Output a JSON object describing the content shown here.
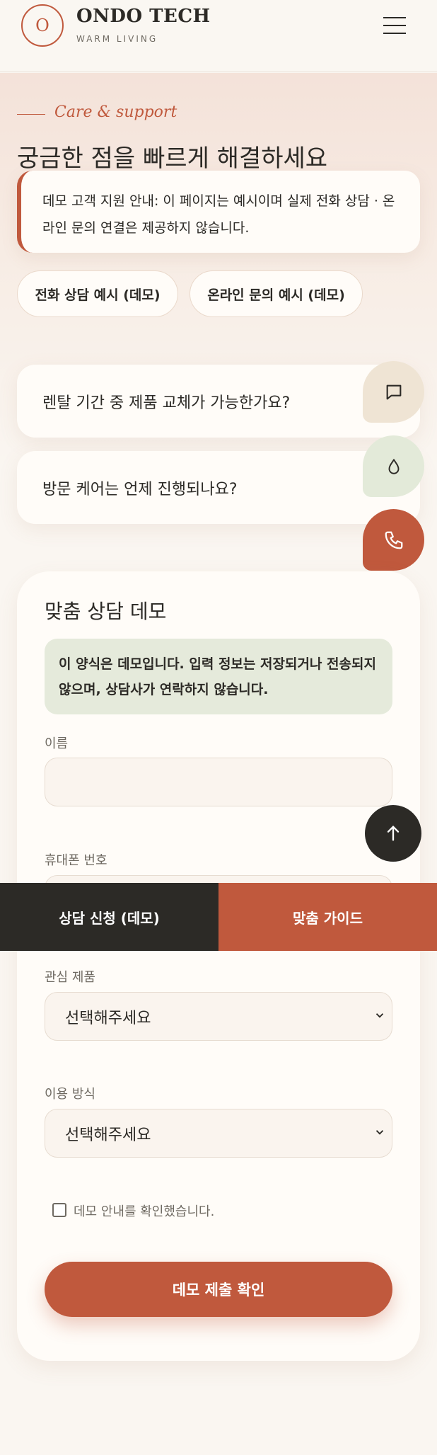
{
  "header": {
    "logo_letter": "O",
    "brand": "ONDO TECH",
    "tagline": "WARM LIVING",
    "menu_icon": "hamburger-icon"
  },
  "hero": {
    "eyebrow": "Care & support",
    "title": "궁금한 점을 빠르게 해결하세요",
    "notice": "데모 고객 지원 안내: 이 페이지는 예시이며 실제 전화 상담 · 온라인 문의 연결은 제공하지 않습니다.",
    "buttons": [
      {
        "label": "전화 상담 예시 (데모)"
      },
      {
        "label": "온라인 문의 예시 (데모)"
      }
    ]
  },
  "faq": [
    {
      "question": "렌탈 기간 중 제품 교체가 가능한가요?"
    },
    {
      "question": "방문 케어는 언제 진행되나요?"
    }
  ],
  "floating": {
    "chat_icon": "chat-bubble-icon",
    "drop_icon": "water-drop-icon",
    "phone_icon": "phone-icon",
    "scroll_top_icon": "arrow-up-icon",
    "colors": {
      "chat": "#efe4d4",
      "drop": "#e3ead9",
      "phone": "#c0593d",
      "top": "#2c2a26"
    }
  },
  "form": {
    "title": "맞춤 상담 데모",
    "note": "이 양식은 데모입니다. 입력 정보는 저장되거나 전송되지 않으며, 상담사가 연락하지 않습니다.",
    "name_label": "이름",
    "name_value": "",
    "phone_label": "휴대폰 번호",
    "phone_value": "",
    "product_label": "관심 제품",
    "product_selected": "선택해주세요",
    "usage_label": "이용 방식",
    "usage_selected": "선택해주세요",
    "consent_label": "데모 안내를 확인했습니다.",
    "consent_checked": false,
    "submit_label": "데모 제출 확인"
  },
  "bottom_bar": {
    "left_label": "상담 신청 (데모)",
    "right_label": "맞춤 가이드"
  },
  "colors": {
    "accent": "#c0593d",
    "dark": "#2c2a26",
    "background": "#faf6f1",
    "note_green": "#e5eadb"
  }
}
